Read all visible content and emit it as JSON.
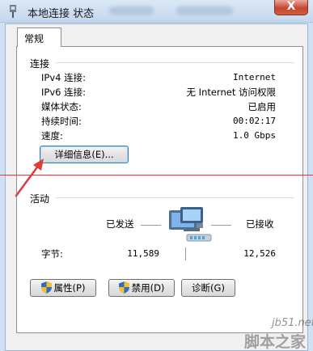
{
  "window": {
    "title": "本地连接 状态",
    "close_glyph": "X"
  },
  "tab": {
    "label": "常规"
  },
  "connection": {
    "section_title": "连接",
    "rows": [
      {
        "label": "IPv4 连接:",
        "value": "Internet"
      },
      {
        "label": "IPv6 连接:",
        "value": "无 Internet 访问权限"
      },
      {
        "label": "媒体状态:",
        "value": "已启用"
      },
      {
        "label": "持续时间:",
        "value": "00:02:17"
      },
      {
        "label": "速度:",
        "value": "1.0 Gbps"
      }
    ],
    "details_button": "详细信息(E)..."
  },
  "activity": {
    "section_title": "活动",
    "sent_label": "已发送",
    "received_label": "已接收",
    "bytes_label": "字节:",
    "bytes_sent": "11,589",
    "bytes_received": "12,526"
  },
  "buttons": {
    "properties": "属性(P)",
    "disable": "禁用(D)",
    "diagnose": "诊断(G)"
  },
  "watermark": {
    "site": "jb51.net",
    "brand": "脚本之家"
  },
  "colors": {
    "annotation_red": "#e03a3a",
    "shield_blue": "#2f6fc0",
    "shield_yellow": "#f2c12e"
  },
  "icons": {
    "title": "network-adapter-icon",
    "activity": "network-computer-icon",
    "shield": "uac-shield-icon"
  }
}
